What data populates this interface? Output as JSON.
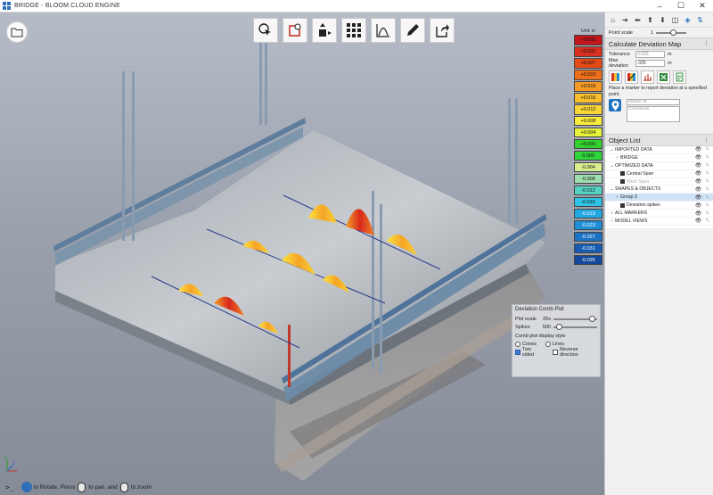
{
  "window": {
    "title": "BRIDGE - BLOOM CLOUD ENGINE",
    "minimize": "–",
    "maximize": "☐",
    "close": "✕"
  },
  "legend": {
    "unit": "Unit: m",
    "items": [
      {
        "label": "+0.035",
        "color": "#c4161c"
      },
      {
        "label": "+0.031",
        "color": "#d83020"
      },
      {
        "label": "+0.027",
        "color": "#e64a17"
      },
      {
        "label": "+0.023",
        "color": "#ef6e1a"
      },
      {
        "label": "+0.019",
        "color": "#f49a24"
      },
      {
        "label": "+0.016",
        "color": "#f8be2c"
      },
      {
        "label": "+0.012",
        "color": "#fad737"
      },
      {
        "label": "+0.008",
        "color": "#fbec3c"
      },
      {
        "label": "+0.004",
        "color": "#e6f23c"
      },
      {
        "label": "+0.000",
        "color": "#33d12c"
      },
      {
        "label": "0.000",
        "color": "#2fd63a"
      },
      {
        "label": "-0.004",
        "color": "#d9ee8e"
      },
      {
        "label": "-0.008",
        "color": "#9edfb0"
      },
      {
        "label": "-0.012",
        "color": "#54d3c4"
      },
      {
        "label": "-0.016",
        "color": "#2fc3e6"
      },
      {
        "label": "-0.019",
        "color": "#22a8e2"
      },
      {
        "label": "-0.023",
        "color": "#1e8fd6"
      },
      {
        "label": "-0.027",
        "color": "#1b73c6"
      },
      {
        "label": "-0.031",
        "color": "#175bb2"
      },
      {
        "label": "-0.035",
        "color": "#14489a"
      }
    ]
  },
  "comb_plot": {
    "title": "Deviation Comb Plot",
    "plot_scale_label": "Plot scale",
    "plot_scale_value": "25x",
    "plot_scale_level": 0.9,
    "spikes_label": "Spikes",
    "spikes_value": "500",
    "spikes_level": 0.15,
    "style_label": "Comb plot display style",
    "cones_label": "Cones",
    "lines_label": "Lines",
    "two_sided_label": "Two sided",
    "two_sided_checked": true,
    "reverse_label": "Reverse direction",
    "reverse_checked": false
  },
  "hint": {
    "prompt": ">_",
    "rotate_label": "to Rotate, Press",
    "pan_label": "to pan, and",
    "zoom_label": "to zoom"
  },
  "axes": {
    "y": "Y",
    "z": "Z"
  },
  "right_panel": {
    "point_scale_label": "Point scale",
    "point_scale_value": "1",
    "point_scale_level": 0.6,
    "deviation": {
      "title": "Calculate Deviation Map",
      "tolerance_label": "Tolerance",
      "tolerance_value": "0.000",
      "tolerance_unit": "m",
      "max_dev_label": "Max deviation",
      "max_dev_value": ".035",
      "max_dev_unit": "m",
      "note": "Place a marker to report deviation at a specified point.",
      "marker_id_placeholder": "Marker ID",
      "comments_placeholder": "Comments"
    },
    "object_list": {
      "title": "Object List",
      "items": [
        {
          "label": "IMPORTED DATA",
          "twisty": "⌄",
          "indent": 0,
          "icon": false,
          "dim": false,
          "selected": false
        },
        {
          "label": "BRIDGE",
          "twisty": "›",
          "indent": 1,
          "icon": false,
          "dim": false,
          "selected": false
        },
        {
          "label": "OPTIMIZED DATA",
          "twisty": "⌄",
          "indent": 0,
          "icon": false,
          "dim": false,
          "selected": false
        },
        {
          "label": "Central Span",
          "twisty": "",
          "indent": 1,
          "icon": true,
          "dim": false,
          "selected": false
        },
        {
          "label": "West Span",
          "twisty": "",
          "indent": 1,
          "icon": true,
          "dim": true,
          "selected": false
        },
        {
          "label": "SHAPES & OBJECTS",
          "twisty": "⌄",
          "indent": 0,
          "icon": false,
          "dim": false,
          "selected": false
        },
        {
          "label": "Group 3",
          "twisty": "›",
          "indent": 1,
          "icon": false,
          "dim": false,
          "selected": true
        },
        {
          "label": "Deviation spikes",
          "twisty": "",
          "indent": 1,
          "icon": true,
          "dim": false,
          "selected": false
        },
        {
          "label": "ALL MARKERS",
          "twisty": "›",
          "indent": 0,
          "icon": false,
          "dim": false,
          "selected": false
        },
        {
          "label": "MODEL VIEWS",
          "twisty": "›",
          "indent": 0,
          "icon": false,
          "dim": false,
          "selected": false
        }
      ]
    }
  }
}
